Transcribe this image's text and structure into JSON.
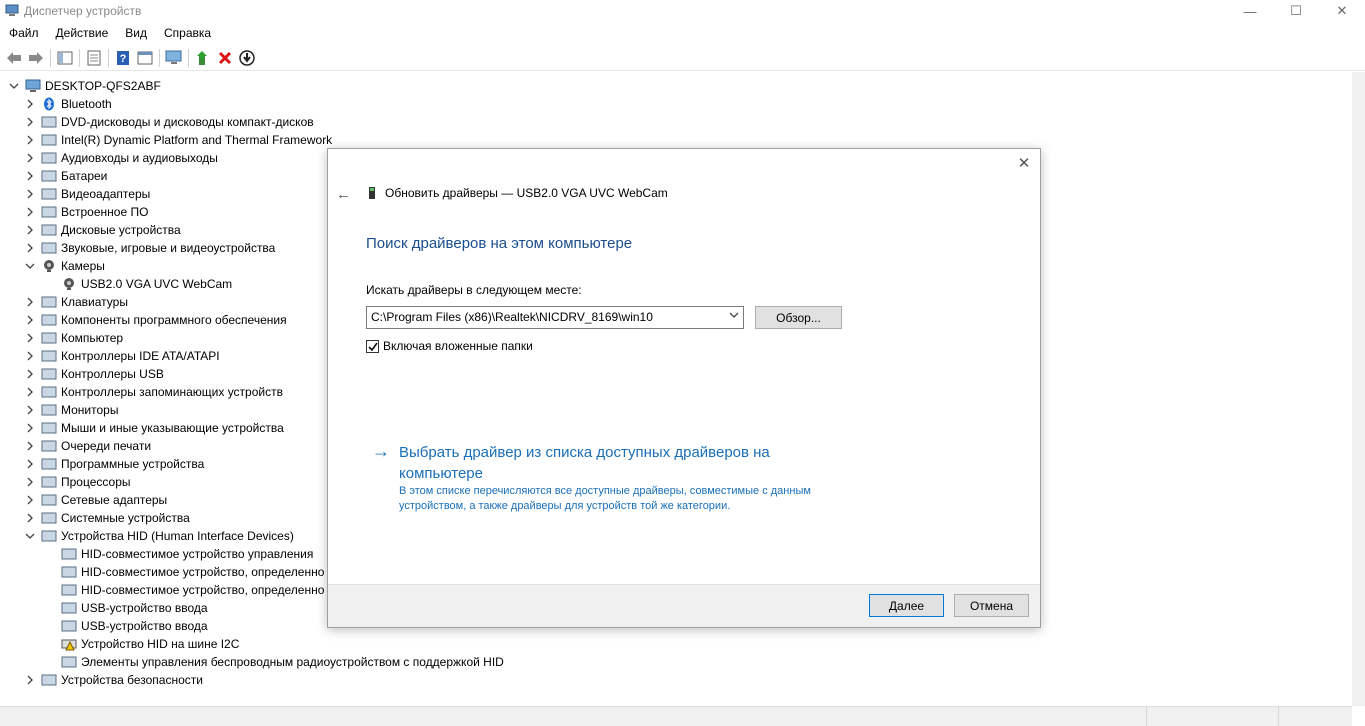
{
  "window": {
    "title": "Диспетчер устройств",
    "minimize": "—",
    "maximize": "☐",
    "close": "✕"
  },
  "menu": [
    "Файл",
    "Действие",
    "Вид",
    "Справка"
  ],
  "tree": {
    "root": "DESKTOP-QFS2ABF",
    "items": [
      {
        "label": "Bluetooth",
        "level": 1,
        "expanded": false,
        "icon": "bluetooth-icon"
      },
      {
        "label": "DVD-дисководы и дисководы компакт-дисков",
        "level": 1,
        "expanded": false,
        "icon": "dvd-drive-icon"
      },
      {
        "label": "Intel(R) Dynamic Platform and Thermal Framework",
        "level": 1,
        "expanded": false,
        "icon": "chip-icon"
      },
      {
        "label": "Аудиовходы и аудиовыходы",
        "level": 1,
        "expanded": false,
        "icon": "speaker-icon"
      },
      {
        "label": "Батареи",
        "level": 1,
        "expanded": false,
        "icon": "battery-icon"
      },
      {
        "label": "Видеоадаптеры",
        "level": 1,
        "expanded": false,
        "icon": "display-adapter-icon"
      },
      {
        "label": "Встроенное ПО",
        "level": 1,
        "expanded": false,
        "icon": "firmware-icon"
      },
      {
        "label": "Дисковые устройства",
        "level": 1,
        "expanded": false,
        "icon": "disk-drive-icon"
      },
      {
        "label": "Звуковые, игровые и видеоустройства",
        "level": 1,
        "expanded": false,
        "icon": "sound-icon"
      },
      {
        "label": "Камеры",
        "level": 1,
        "expanded": true,
        "icon": "camera-icon"
      },
      {
        "label": "USB2.0 VGA UVC WebCam",
        "level": 2,
        "icon": "webcam-icon"
      },
      {
        "label": "Клавиатуры",
        "level": 1,
        "expanded": false,
        "icon": "keyboard-icon"
      },
      {
        "label": "Компоненты программного обеспечения",
        "level": 1,
        "expanded": false,
        "icon": "software-component-icon"
      },
      {
        "label": "Компьютер",
        "level": 1,
        "expanded": false,
        "icon": "computer-icon"
      },
      {
        "label": "Контроллеры IDE ATA/ATAPI",
        "level": 1,
        "expanded": false,
        "icon": "ide-controller-icon"
      },
      {
        "label": "Контроллеры USB",
        "level": 1,
        "expanded": false,
        "icon": "usb-icon"
      },
      {
        "label": "Контроллеры запоминающих устройств",
        "level": 1,
        "expanded": false,
        "icon": "storage-controller-icon"
      },
      {
        "label": "Мониторы",
        "level": 1,
        "expanded": false,
        "icon": "monitor-icon"
      },
      {
        "label": "Мыши и иные указывающие устройства",
        "level": 1,
        "expanded": false,
        "icon": "mouse-icon"
      },
      {
        "label": "Очереди печати",
        "level": 1,
        "expanded": false,
        "icon": "printer-icon"
      },
      {
        "label": "Программные устройства",
        "level": 1,
        "expanded": false,
        "icon": "software-device-icon"
      },
      {
        "label": "Процессоры",
        "level": 1,
        "expanded": false,
        "icon": "processor-icon"
      },
      {
        "label": "Сетевые адаптеры",
        "level": 1,
        "expanded": false,
        "icon": "network-adapter-icon"
      },
      {
        "label": "Системные устройства",
        "level": 1,
        "expanded": false,
        "icon": "system-device-icon"
      },
      {
        "label": "Устройства HID (Human Interface Devices)",
        "level": 1,
        "expanded": true,
        "icon": "hid-icon"
      },
      {
        "label": "HID-совместимое устройство управления",
        "level": 2,
        "icon": "hid-icon"
      },
      {
        "label": "HID-совместимое устройство, определенно",
        "level": 2,
        "icon": "hid-icon"
      },
      {
        "label": "HID-совместимое устройство, определенно",
        "level": 2,
        "icon": "hid-icon"
      },
      {
        "label": "USB-устройство ввода",
        "level": 2,
        "icon": "hid-icon"
      },
      {
        "label": "USB-устройство ввода",
        "level": 2,
        "icon": "hid-icon"
      },
      {
        "label": "Устройство HID на шине I2C",
        "level": 2,
        "icon": "hid-warning-icon"
      },
      {
        "label": "Элементы управления беспроводным радиоустройством с поддержкой HID",
        "level": 2,
        "icon": "hid-icon"
      },
      {
        "label": "Устройства безопасности",
        "level": 1,
        "expanded": false,
        "icon": "security-device-icon"
      }
    ]
  },
  "dialog": {
    "header": "Обновить драйверы — USB2.0 VGA UVC WebCam",
    "heading": "Поиск драйверов на этом компьютере",
    "search_label": "Искать драйверы в следующем месте:",
    "path_value": "C:\\Program Files (x86)\\Realtek\\NICDRV_8169\\win10",
    "browse_label": "Обзор...",
    "include_subfolders_label": "Включая вложенные папки",
    "include_subfolders_checked": true,
    "pick_link_title": "Выбрать драйвер из списка доступных драйверов на компьютере",
    "pick_link_desc": "В этом списке перечисляются все доступные драйверы, совместимые с данным устройством, а также драйверы для устройств той же категории.",
    "next_label": "Далее",
    "cancel_label": "Отмена"
  },
  "colors": {
    "link": "#1a6fb8",
    "heading": "#1a4e8c",
    "title_text": "#8a8a8a"
  }
}
